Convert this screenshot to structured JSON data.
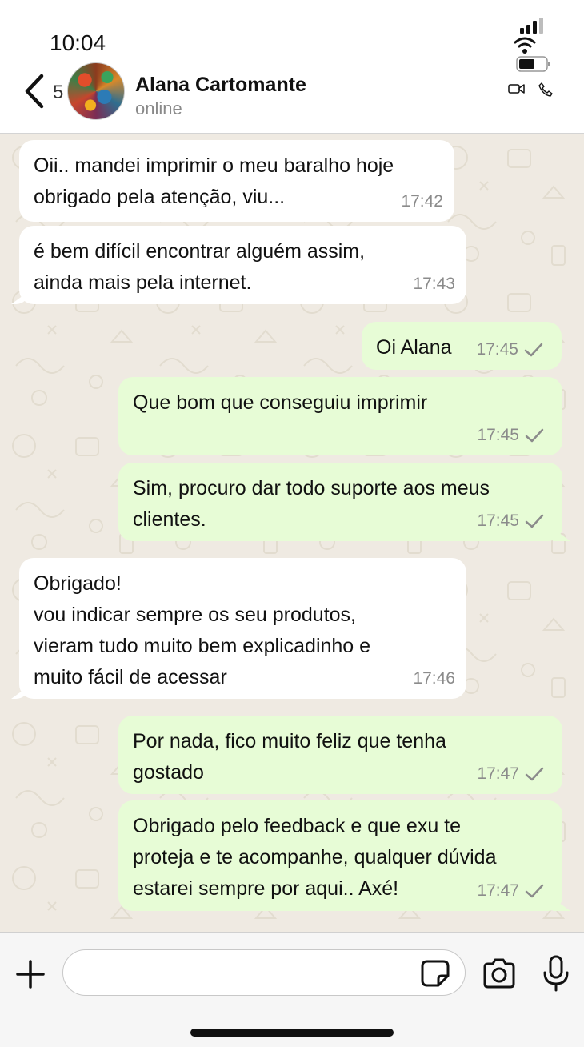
{
  "status_bar": {
    "time": "10:04"
  },
  "header": {
    "back_count": "5",
    "contact_name": "Alana Cartomante",
    "contact_status": "online",
    "icons": [
      "back-chevron-icon",
      "video-camera-icon",
      "phone-icon"
    ]
  },
  "messages": [
    {
      "direction": "in",
      "text": "Oii.. mandei imprimir o meu baralho hoje\nobrigado pela atenção, viu...",
      "time": "17:42"
    },
    {
      "direction": "in",
      "text": "é bem difícil encontrar alguém assim,\nainda mais pela internet.",
      "time": "17:43"
    },
    {
      "direction": "out",
      "text": "Oi Alana",
      "time": "17:45",
      "status": "sent"
    },
    {
      "direction": "out",
      "text": "Que bom que conseguiu imprimir",
      "time": "17:45",
      "status": "sent"
    },
    {
      "direction": "out",
      "text": "Sim, procuro dar todo suporte aos meus\nclientes.",
      "time": "17:45",
      "status": "sent"
    },
    {
      "direction": "in",
      "text": "Obrigado!\nvou indicar sempre os seu produtos,\nvieram tudo muito bem explicadinho e\nmuito fácil de acessar",
      "time": "17:46"
    },
    {
      "direction": "out",
      "text": "Por nada, fico muito feliz que tenha\ngostado",
      "time": "17:47",
      "status": "sent"
    },
    {
      "direction": "out",
      "text": "Obrigado pelo feedback e que exu te\nproteja e te acompanhe, qualquer dúvida\nestarei sempre por aqui.. Axé!",
      "time": "17:47",
      "status": "sent"
    }
  ],
  "input_bar": {
    "placeholder": "",
    "icons": [
      "plus-icon",
      "sticker-icon",
      "camera-icon",
      "microphone-icon"
    ]
  }
}
